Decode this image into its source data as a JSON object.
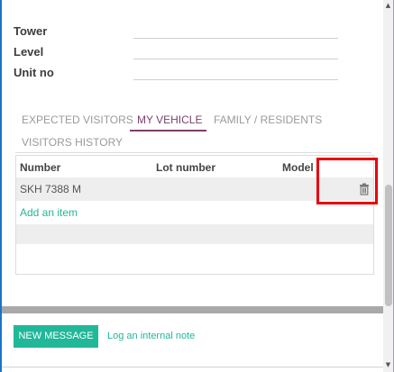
{
  "form": {
    "fields": [
      {
        "label": "Tower",
        "value": ""
      },
      {
        "label": "Level",
        "value": ""
      },
      {
        "label": "Unit no",
        "value": ""
      }
    ]
  },
  "tabs": [
    {
      "label": "EXPECTED VISITORS",
      "active": false
    },
    {
      "label": "MY VEHICLE",
      "active": true
    },
    {
      "label": "FAMILY / RESIDENTS",
      "active": false
    },
    {
      "label": "VISITORS HISTORY",
      "active": false
    }
  ],
  "vehicle_table": {
    "columns": [
      "Number",
      "Lot number",
      "Model"
    ],
    "rows": [
      {
        "number": "SKH 7388 M",
        "lot_number": "",
        "model": "",
        "action_icon": "trash-icon"
      }
    ],
    "add_item_label": "Add an item"
  },
  "chatter": {
    "new_message_label": "NEW MESSAGE",
    "log_note_label": "Log an internal note"
  },
  "colors": {
    "accent_teal": "#21b799",
    "active_tab": "#7c3f6c",
    "highlight_box": "#e8000b"
  }
}
